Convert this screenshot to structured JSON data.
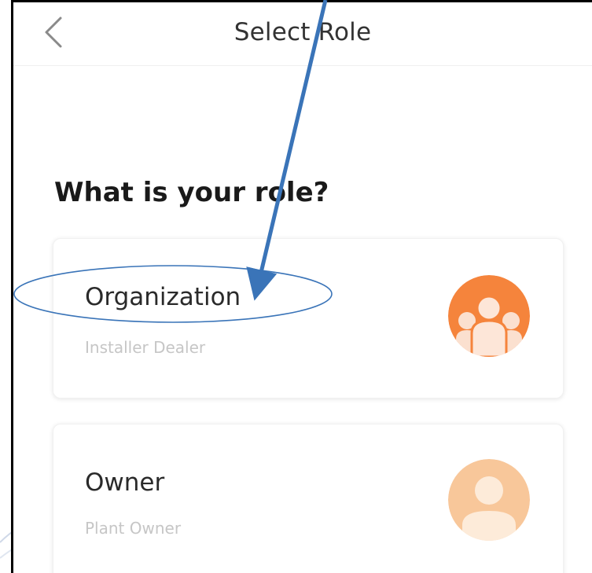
{
  "header": {
    "title": "Select Role",
    "back_icon": "chevron-left-icon"
  },
  "main": {
    "question": "What is your role?",
    "roles": [
      {
        "title": "Organization",
        "subtitle": "Installer Dealer",
        "icon": "group-icon",
        "icon_color": "#f5843c"
      },
      {
        "title": "Owner",
        "subtitle": "Plant Owner",
        "icon": "person-icon",
        "icon_color": "#f8c79a"
      }
    ]
  },
  "colors": {
    "annotation_blue": "#3a74b8",
    "accent_orange": "#f5843c",
    "light_orange": "#f8c79a"
  }
}
